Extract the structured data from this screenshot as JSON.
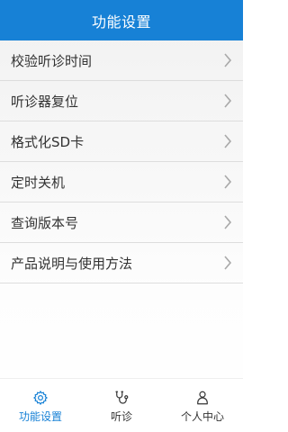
{
  "header": {
    "title": "功能设置"
  },
  "menu": {
    "items": [
      {
        "label": "校验听诊时间",
        "icon": "chevron-right-icon"
      },
      {
        "label": "听诊器复位",
        "icon": "chevron-right-icon"
      },
      {
        "label": "格式化SD卡",
        "icon": "chevron-right-icon"
      },
      {
        "label": "定时关机",
        "icon": "chevron-right-icon"
      },
      {
        "label": "查询版本号",
        "icon": "chevron-right-icon"
      },
      {
        "label": "产品说明与使用方法",
        "icon": "chevron-right-icon"
      }
    ]
  },
  "tabbar": {
    "tabs": [
      {
        "label": "功能设置",
        "icon": "gear-icon",
        "active": true
      },
      {
        "label": "听诊",
        "icon": "stethoscope-icon",
        "active": false
      },
      {
        "label": "个人中心",
        "icon": "person-icon",
        "active": false
      }
    ]
  },
  "colors": {
    "accent": "#1781d6",
    "header_text": "#ffffff",
    "item_text": "#333333",
    "divider": "#dddddd",
    "chevron": "#a9a9a9"
  }
}
